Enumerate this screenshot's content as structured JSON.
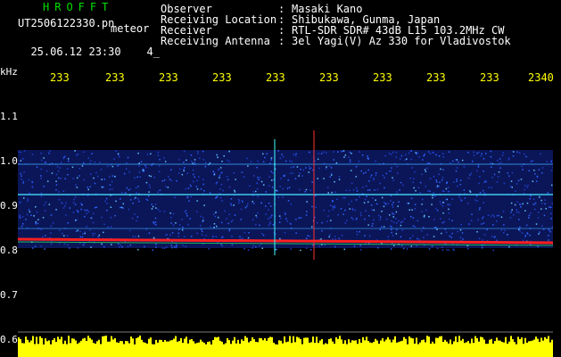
{
  "header": {
    "app_title": "HROFFT",
    "file_name": "UT2506122330.pn",
    "file_suffix": "meteor",
    "date_time": "25.06.12 23:30",
    "counter": "4_"
  },
  "meta": [
    {
      "label": "Observer",
      "value": "Masaki Kano"
    },
    {
      "label": "Receiving Location",
      "value": "Shibukawa, Gunma, Japan"
    },
    {
      "label": "Receiver",
      "value": "RTL-SDR SDR# 43dB L15 103.2MHz CW"
    },
    {
      "label": "Receiving Antenna",
      "value": "3el Yagi(V) Az 330 for Vladivostok"
    }
  ],
  "separator": ":",
  "axis": {
    "unit": "kHz",
    "y_labels": [
      "1.1",
      "1.0",
      "0.9",
      "0.8",
      "0.7",
      "0.6"
    ],
    "x_labels": [
      "233",
      "233",
      "233",
      "233",
      "233",
      "233",
      "233",
      "233",
      "233",
      "2340"
    ]
  },
  "colors": {
    "title": "#00e000",
    "ticks": "#ffff00",
    "text": "#ffffff",
    "background": "#000000",
    "noise": "#1e3cc8",
    "echo": "#ff2020",
    "amplitude": "#ffff00"
  }
}
